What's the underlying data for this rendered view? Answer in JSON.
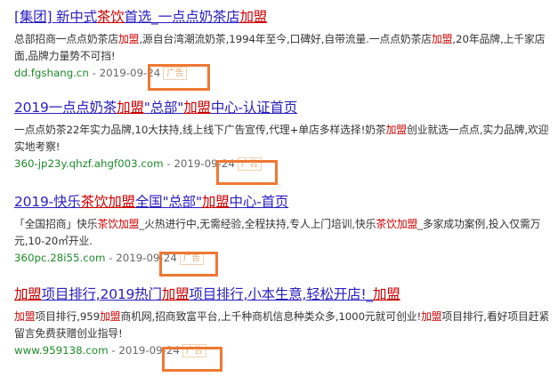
{
  "results": [
    {
      "title": [
        {
          "t": "[集团] 新中式"
        },
        {
          "t": "茶饮",
          "kw": true
        },
        {
          "t": "首选_一点点奶茶店"
        },
        {
          "t": "加盟",
          "kw": true
        }
      ],
      "abstract": [
        {
          "t": "总部招商一点点奶茶店"
        },
        {
          "t": "加盟",
          "kw": true
        },
        {
          "t": ",源自台湾潮流奶茶,1994年至今,口碑好,自带流量.一点点奶茶店"
        },
        {
          "t": "加盟",
          "kw": true
        },
        {
          "t": ",20年品牌,上千家店面,品牌力量势不可挡!"
        }
      ],
      "url": "dd.fgshang.cn",
      "date": "2019-09-24",
      "ad": "广告"
    },
    {
      "title": [
        {
          "t": "2019一点点奶茶"
        },
        {
          "t": "加盟",
          "kw": true
        },
        {
          "t": "\"总部\""
        },
        {
          "t": "加盟",
          "kw": true
        },
        {
          "t": "中心-认证首页"
        }
      ],
      "abstract": [
        {
          "t": "一点点奶茶22年实力品牌,10大扶持,线上线下广告宣传,代理+单店多样选择!奶茶"
        },
        {
          "t": "加盟",
          "kw": true
        },
        {
          "t": "创业就选一点点,实力品牌,欢迎实地考察!"
        }
      ],
      "url": "360-jp23y.qhzf.ahgf003.com",
      "date": "2019-09-24",
      "ad": "广告"
    },
    {
      "title": [
        {
          "t": "2019-快乐"
        },
        {
          "t": "茶饮加盟",
          "kw": true
        },
        {
          "t": "全国\"总部\""
        },
        {
          "t": "加盟",
          "kw": true
        },
        {
          "t": "中心-首页"
        }
      ],
      "abstract": [
        {
          "t": "「全国招商」快乐"
        },
        {
          "t": "茶饮加盟",
          "kw": true
        },
        {
          "t": "_火热进行中,无需经验,全程扶持,专人上门培训,快乐"
        },
        {
          "t": "茶饮加盟",
          "kw": true
        },
        {
          "t": "_多家成功案例,投入仅需万元,10-20㎡开业."
        }
      ],
      "url": "360pc.28i55.com",
      "date": "2019-09-24",
      "ad": "广告"
    },
    {
      "title": [
        {
          "t": "加盟",
          "kw": true
        },
        {
          "t": "项目排行,2019热门"
        },
        {
          "t": "加盟",
          "kw": true
        },
        {
          "t": "项目排行,小本生意,轻松开店!_"
        },
        {
          "t": "加盟",
          "kw": true
        }
      ],
      "abstract": [
        {
          "t": "加盟",
          "kw": true
        },
        {
          "t": "项目排行,959"
        },
        {
          "t": "加盟",
          "kw": true
        },
        {
          "t": "商机网,招商致富平台,上千种商机信息种类众多,1000元就可创业!"
        },
        {
          "t": "加盟",
          "kw": true
        },
        {
          "t": "项目排行,看好项目赶紧留言免费获赠创业指导!"
        }
      ],
      "url": "www.959138.com",
      "date": "2019-09-24",
      "ad": "广告"
    }
  ],
  "separator": " - ",
  "colors": {
    "title": "#2a1fbd",
    "keyword": "#cc0000",
    "url": "#1f8a2b",
    "highlight": "#ee7834",
    "ad": "#e0a66a"
  }
}
